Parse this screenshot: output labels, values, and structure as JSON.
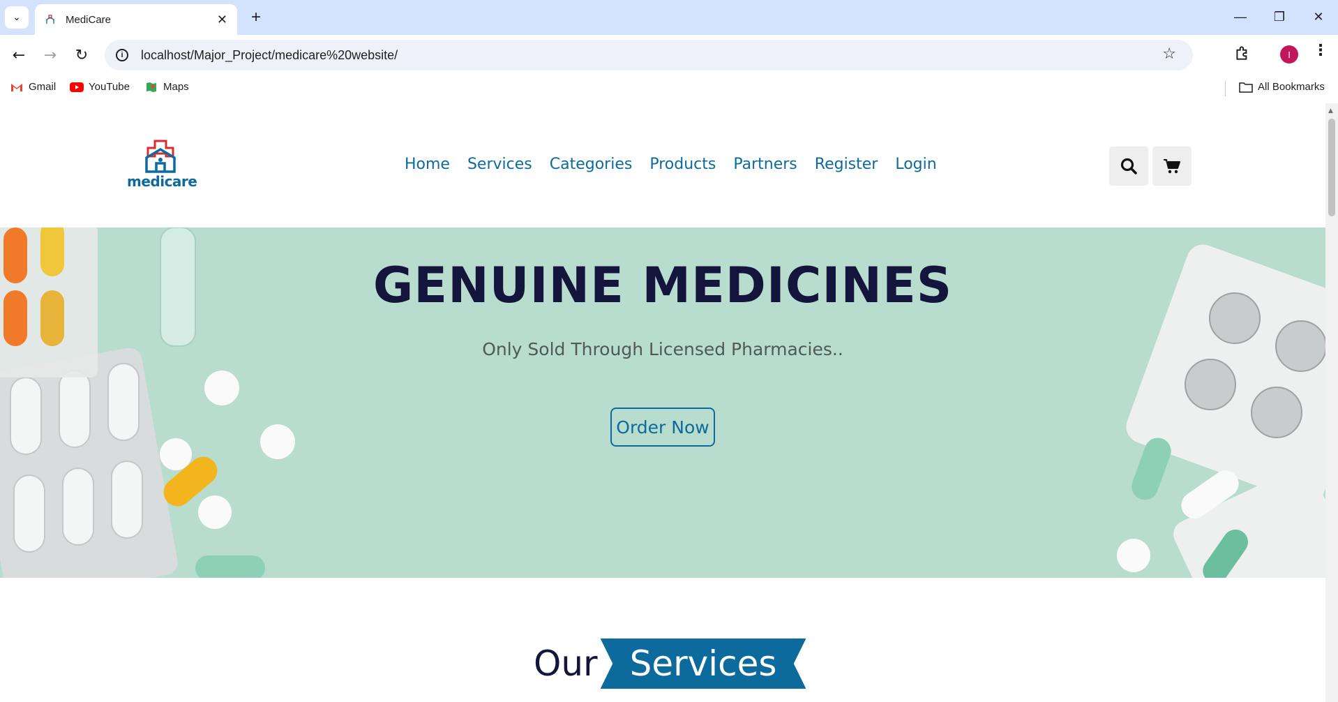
{
  "browser": {
    "tab_title": "MediCare",
    "url": "localhost/Major_Project/medicare%20website/",
    "profile_initial": "I",
    "bookmarks": [
      {
        "label": "Gmail",
        "icon": "gmail-icon"
      },
      {
        "label": "YouTube",
        "icon": "youtube-icon"
      },
      {
        "label": "Maps",
        "icon": "maps-icon"
      }
    ],
    "all_bookmarks": "All Bookmarks"
  },
  "site": {
    "logo_text": "medicare",
    "brand_color": "#0d6a9c",
    "nav": [
      "Home",
      "Services",
      "Categories",
      "Products",
      "Partners",
      "Register",
      "Login"
    ]
  },
  "hero": {
    "title": "GENUINE MEDICINES",
    "subtitle": "Only Sold Through Licensed Pharmacies..",
    "cta": "Order Now",
    "background_color": "#b8dccd"
  },
  "services_section": {
    "heading_prefix": "Our",
    "heading_highlight": "Services"
  }
}
